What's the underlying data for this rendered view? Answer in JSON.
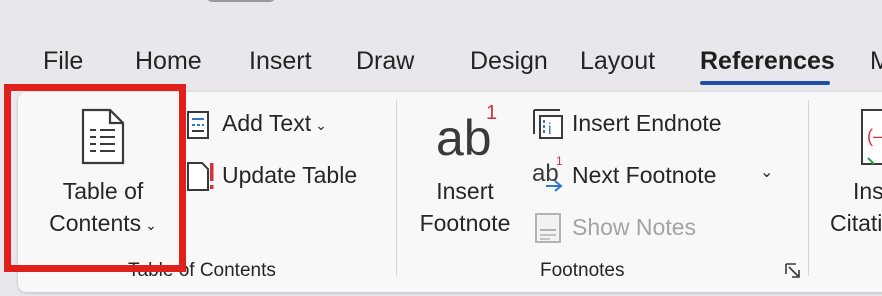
{
  "tabs": [
    {
      "label": "File"
    },
    {
      "label": "Home"
    },
    {
      "label": "Insert"
    },
    {
      "label": "Draw"
    },
    {
      "label": "Design"
    },
    {
      "label": "Layout"
    },
    {
      "label": "References"
    },
    {
      "label": "M"
    }
  ],
  "active_tab": "References",
  "groups": {
    "toc": {
      "label": "Table of Contents",
      "big_button": {
        "line1": "Table of",
        "line2": "Contents",
        "icon": "document-lines-icon"
      },
      "add_text": {
        "label": "Add Text",
        "icon": "add-text-icon"
      },
      "update_table": {
        "label": "Update Table",
        "icon": "update-table-icon"
      }
    },
    "footnotes": {
      "label": "Footnotes",
      "big_button": {
        "glyph": "ab",
        "sup": "1",
        "line1": "Insert",
        "line2": "Footnote"
      },
      "insert_endnote": {
        "label": "Insert Endnote",
        "icon": "insert-endnote-icon",
        "glyph": "i"
      },
      "next_footnote": {
        "label": "Next Footnote",
        "icon": "next-footnote-icon",
        "glyph": "ab",
        "sup": "1"
      },
      "show_notes": {
        "label": "Show Notes",
        "icon": "show-notes-icon"
      }
    },
    "citations": {
      "big_button": {
        "line1": "Ins",
        "line2": "Citati"
      }
    }
  },
  "colors": {
    "accent": "#1e4fa3",
    "highlight": "#e0201b",
    "icon_red": "#d13438",
    "icon_blue": "#2f78c4"
  }
}
